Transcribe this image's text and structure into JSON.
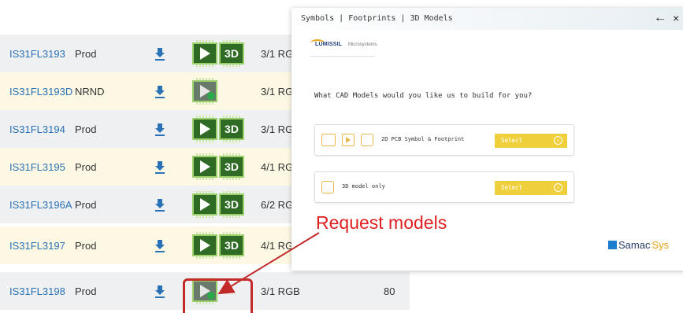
{
  "rows": [
    {
      "part": "IS31FL3193",
      "status": "Prod",
      "models": "full",
      "package": "3/1 RG",
      "qty": ""
    },
    {
      "part": "IS31FL3193D",
      "status": "NRND",
      "models": "request",
      "package": "3/1 RG",
      "qty": ""
    },
    {
      "part": "IS31FL3194",
      "status": "Prod",
      "models": "full",
      "package": "3/1 RG",
      "qty": ""
    },
    {
      "part": "IS31FL3195",
      "status": "Prod",
      "models": "full",
      "package": "4/1 RG",
      "qty": ""
    },
    {
      "part": "IS31FL3196A",
      "status": "Prod",
      "models": "full",
      "package": "6/2 RG",
      "qty": ""
    },
    {
      "part": "IS31FL3197",
      "status": "Prod",
      "models": "full",
      "package": "4/1 RG",
      "qty": ""
    },
    {
      "part": "IS31FL3198",
      "status": "Prod",
      "models": "request",
      "package": "3/1 RGB",
      "qty": "80"
    }
  ],
  "modal": {
    "tabs": "Symbols | Footprints | 3D Models",
    "logo_main": "LUMISSIL",
    "logo_sub": "Microsystems",
    "question": "What CAD Models would you like us to build for you?",
    "options": [
      {
        "label": "2D PCB Symbol & Footprint",
        "button": "Select"
      },
      {
        "label": "3D model only",
        "button": "Select"
      }
    ],
    "brand_a": "Samac",
    "brand_b": "Sys"
  },
  "annotation": {
    "text": "Request models",
    "color": "#e02020"
  },
  "icons": {
    "download": "download-icon",
    "symbol": "symbol-footprint-icon",
    "three_d": "3d-model-icon",
    "request": "request-model-icon",
    "back": "back-arrow-icon",
    "close": "close-icon"
  }
}
